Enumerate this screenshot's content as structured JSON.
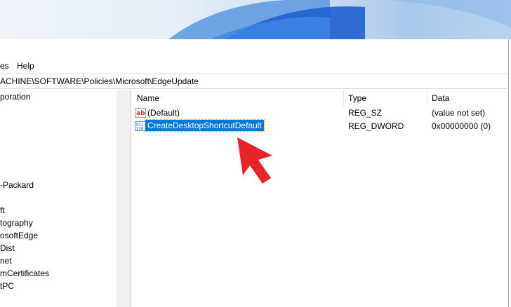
{
  "window": {
    "menu": [
      "es",
      "Help"
    ],
    "address_path": "ACHINE\\SOFTWARE\\Policies\\Microsoft\\EdgeUpdate"
  },
  "tree": {
    "items": [
      "poration",
      "-Packard",
      "ft",
      "tography",
      "osoftEdge",
      "Dist",
      "net",
      "mCertificates",
      "tPC"
    ]
  },
  "list": {
    "columns": [
      "Name",
      "Type",
      "Data"
    ],
    "rows": [
      {
        "name": "(Default)",
        "type": "REG_SZ",
        "data": "(value not set)",
        "icon": "reg-sz-icon"
      },
      {
        "name": "CreateDesktopShortcutDefault",
        "type": "REG_DWORD",
        "data": "0x00000000 (0)",
        "icon": "reg-dword-icon",
        "selected": true
      }
    ]
  },
  "colors": {
    "selection": "#0078d7",
    "arrow": "#e8242b"
  }
}
